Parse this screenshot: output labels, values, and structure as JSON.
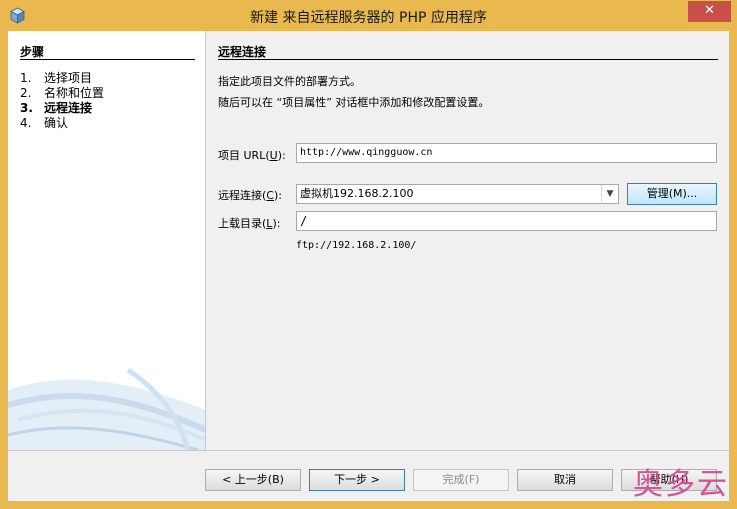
{
  "window": {
    "title": "新建 来自远程服务器的 PHP 应用程序",
    "close_label": "✕"
  },
  "steps": {
    "title": "步骤",
    "items": [
      {
        "num": "1.",
        "label": "选择项目"
      },
      {
        "num": "2.",
        "label": "名称和位置"
      },
      {
        "num": "3.",
        "label": "远程连接"
      },
      {
        "num": "4.",
        "label": "确认"
      }
    ]
  },
  "page": {
    "title": "远程连接",
    "description_line1": "指定此项目文件的部署方式。",
    "description_line2": "随后可以在 “项目属性” 对话框中添加和修改配置设置。"
  },
  "form": {
    "project_url_label": "项目 URL(",
    "project_url_key": "U",
    "project_url_label_end": "):",
    "project_url_value": "http://www.qingguow.cn",
    "remote_connection_label": "远程连接(",
    "remote_connection_key": "C",
    "remote_connection_label_end": "):",
    "remote_connection_value": "虚拟机192.168.2.100",
    "manage_button": "管理(M)...",
    "upload_dir_label": "上载目录(",
    "upload_dir_key": "L",
    "upload_dir_label_end": "):",
    "upload_dir_value": "/",
    "upload_hint": "ftp://192.168.2.100/"
  },
  "buttons": {
    "back": "< 上一步(B)",
    "next": "下一步 >",
    "finish": "完成(F)",
    "cancel": "取消",
    "help": "帮助(H)"
  },
  "watermark": "奥多云",
  "colors": {
    "titlebar": "#e9b84e",
    "close": "#c7504b",
    "watermark": "#d64a93"
  }
}
